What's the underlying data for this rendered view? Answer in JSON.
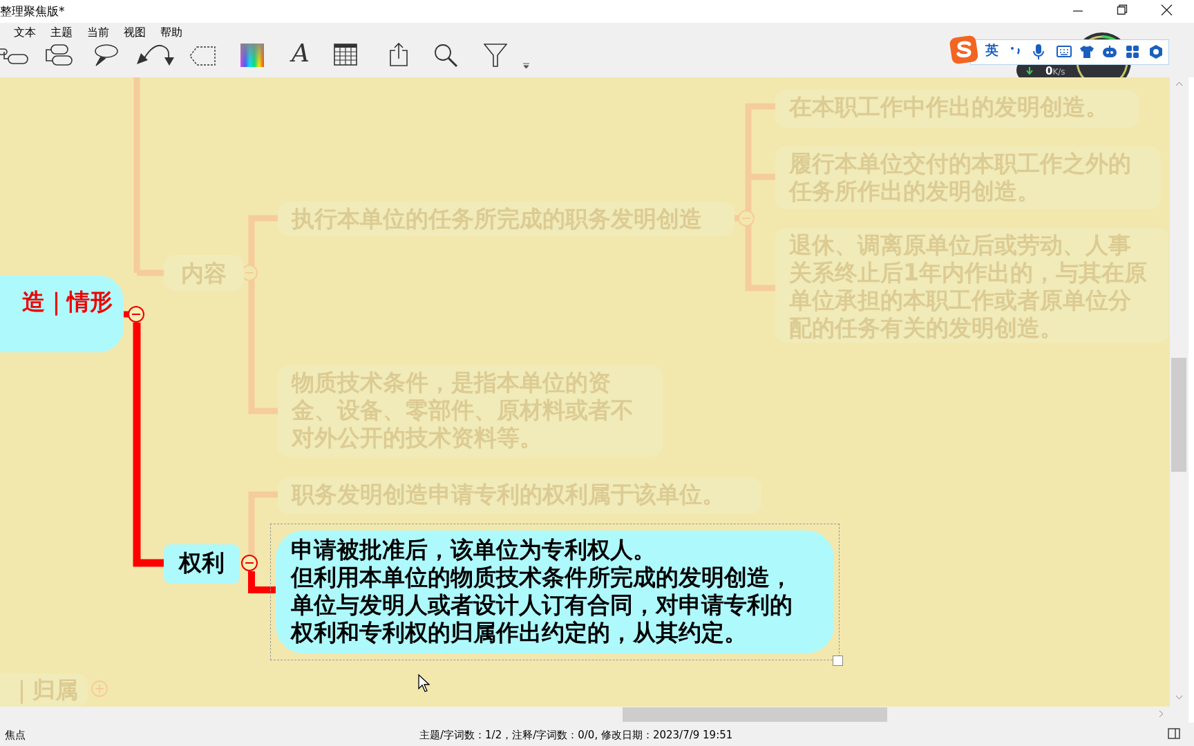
{
  "window": {
    "title": "整理聚焦版*"
  },
  "menu": [
    {
      "label": "文本"
    },
    {
      "label": "主题"
    },
    {
      "label": "当前"
    },
    {
      "label": "视图"
    },
    {
      "label": "帮助"
    }
  ],
  "toolbar": {
    "font_button_label": "A"
  },
  "ime_bar": {
    "language": "英"
  },
  "network_widget": {
    "value": "0",
    "unit": "K/s"
  },
  "mind_map": {
    "nodes": [
      {
        "kind": "root",
        "lines": [
          "造｜情形"
        ],
        "dimmed": false,
        "selected": false,
        "expanded": true
      },
      {
        "kind": "topic",
        "lines": [
          "内容"
        ],
        "dimmed": true,
        "selected": false,
        "expanded": true
      },
      {
        "kind": "subtopic",
        "lines": [
          "执行本单位的任务所完成的职务发明创造"
        ],
        "dimmed": true,
        "selected": false,
        "expanded": true
      },
      {
        "kind": "subtopic",
        "lines": [
          "在本职工作中作出的发明创造。"
        ],
        "dimmed": true,
        "selected": false
      },
      {
        "kind": "subtopic",
        "lines": [
          "履行本单位交付的本职工作之外的",
          "任务所作出的发明创造。"
        ],
        "dimmed": true,
        "selected": false
      },
      {
        "kind": "subtopic",
        "lines": [
          "退休、调离原单位后或劳动、人事",
          "关系终止后1年内作出的，与其在原",
          "单位承担的本职工作或者原单位分",
          "配的任务有关的发明创造。"
        ],
        "dimmed": true,
        "selected": false
      },
      {
        "kind": "subtopic",
        "lines": [
          "物质技术条件，是指本单位的资",
          "金、设备、零部件、原材料或者不",
          "对外公开的技术资料等。"
        ],
        "dimmed": true,
        "selected": false
      },
      {
        "kind": "subtopic",
        "lines": [
          "职务发明创造申请专利的权利属于该单位。"
        ],
        "dimmed": true,
        "selected": false
      },
      {
        "kind": "topic",
        "lines": [
          "权利"
        ],
        "dimmed": false,
        "selected": false,
        "expanded": true
      },
      {
        "kind": "subtopic",
        "lines": [
          "申请被批准后，该单位为专利权人。",
          "但利用本单位的物质技术条件所完成的发明创造，",
          "单位与发明人或者设计人订有合同，对申请专利的",
          "权利和专利权的归属作出约定的，从其约定。"
        ],
        "dimmed": false,
        "selected": true
      },
      {
        "kind": "root",
        "lines": [
          "｜归属"
        ],
        "dimmed": true,
        "selected": false,
        "expanded": false
      }
    ]
  },
  "status_bar": {
    "left": "焦点",
    "info": "主题/字词数：1/2，注释/字词数：0/0, 修改日期：2023/7/9 19:51"
  }
}
